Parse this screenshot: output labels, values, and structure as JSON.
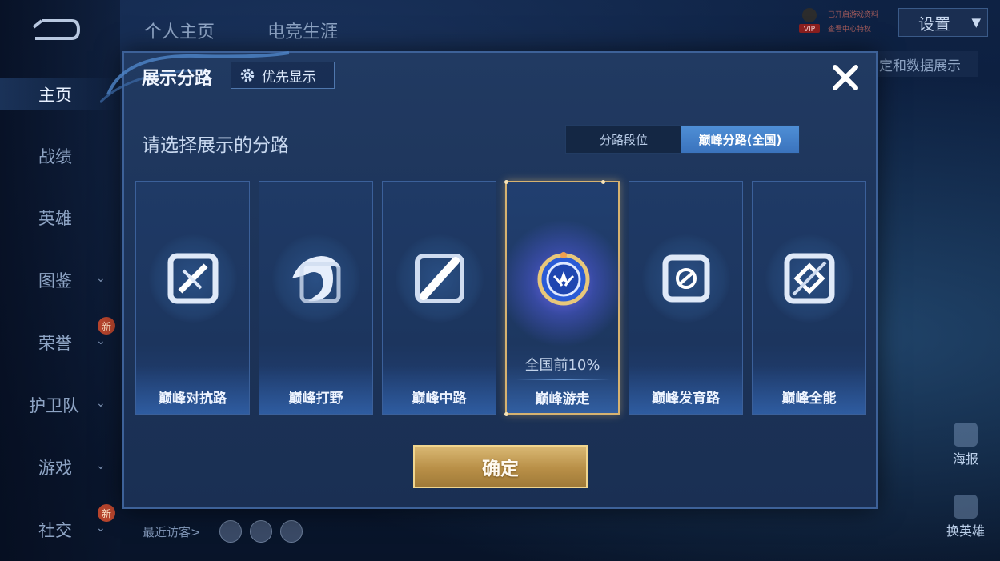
{
  "sidebar": {
    "items": [
      {
        "label": "主页",
        "active": true,
        "has_chevron": false,
        "badge": ""
      },
      {
        "label": "战绩",
        "active": false,
        "has_chevron": false,
        "badge": ""
      },
      {
        "label": "英雄",
        "active": false,
        "has_chevron": false,
        "badge": ""
      },
      {
        "label": "图鉴",
        "active": false,
        "has_chevron": true,
        "badge": ""
      },
      {
        "label": "荣誉",
        "active": false,
        "has_chevron": true,
        "badge": "新"
      },
      {
        "label": "护卫队",
        "active": false,
        "has_chevron": true,
        "badge": ""
      },
      {
        "label": "游戏",
        "active": false,
        "has_chevron": true,
        "badge": ""
      },
      {
        "label": "社交",
        "active": false,
        "has_chevron": true,
        "badge": "新"
      }
    ]
  },
  "header": {
    "tabs": [
      "个人主页",
      "电竞生涯"
    ],
    "vip_label": "VIP",
    "vip_lines": [
      "已开启游戏资料",
      "查看中心特权"
    ],
    "settings_label": "设置",
    "right_tab_label": "定和数据展示"
  },
  "right_panel": {
    "icons": [
      {
        "label": "海报",
        "icon": "poster-icon"
      },
      {
        "label": "换英雄",
        "icon": "swap-hero-icon"
      }
    ]
  },
  "footer": {
    "recent_visitors_label": "最近访客>"
  },
  "modal": {
    "title": "展示分路",
    "priority_button": "优先显示",
    "subtitle": "请选择展示的分路",
    "segment": {
      "options": [
        "分路段位",
        "巅峰分路(全国)"
      ],
      "selected_index": 1
    },
    "lanes": [
      {
        "name": "巅峰对抗路",
        "icon": "sword-emblem-icon",
        "selected": false,
        "rank": ""
      },
      {
        "name": "巅峰打野",
        "icon": "dragon-emblem-icon",
        "selected": false,
        "rank": ""
      },
      {
        "name": "巅峰中路",
        "icon": "staff-emblem-icon",
        "selected": false,
        "rank": ""
      },
      {
        "name": "巅峰游走",
        "icon": "wing-shield-emblem-icon",
        "selected": true,
        "rank": "全国前10%"
      },
      {
        "name": "巅峰发育路",
        "icon": "arrow-emblem-icon",
        "selected": false,
        "rank": ""
      },
      {
        "name": "巅峰全能",
        "icon": "diamond-emblem-icon",
        "selected": false,
        "rank": ""
      }
    ],
    "confirm_label": "确定",
    "accent_color": "#d6b270",
    "selected_tab_color": "#4f8fd6"
  }
}
